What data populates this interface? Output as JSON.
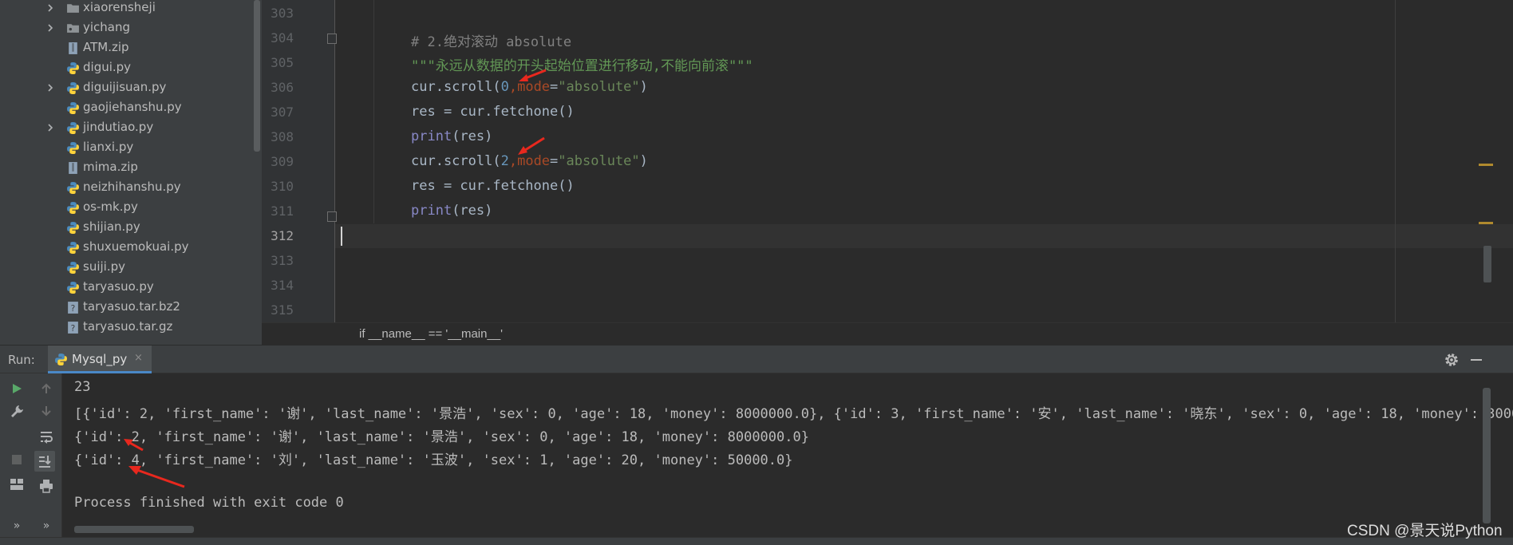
{
  "project_tree": {
    "items": [
      {
        "label": "xiaorensheji",
        "type": "folder",
        "expandable": true
      },
      {
        "label": "yichang",
        "type": "package",
        "expandable": true
      },
      {
        "label": "ATM.zip",
        "type": "zip",
        "expandable": false
      },
      {
        "label": "digui.py",
        "type": "python",
        "expandable": false
      },
      {
        "label": "diguijisuan.py",
        "type": "python",
        "expandable": true
      },
      {
        "label": "gaojiehanshu.py",
        "type": "python",
        "expandable": false
      },
      {
        "label": "jindutiao.py",
        "type": "python",
        "expandable": true
      },
      {
        "label": "lianxi.py",
        "type": "python",
        "expandable": false
      },
      {
        "label": "mima.zip",
        "type": "zip",
        "expandable": false
      },
      {
        "label": "neizhihanshu.py",
        "type": "python",
        "expandable": false
      },
      {
        "label": "os-mk.py",
        "type": "python",
        "expandable": false
      },
      {
        "label": "shijian.py",
        "type": "python",
        "expandable": false
      },
      {
        "label": "shuxuemokuai.py",
        "type": "python",
        "expandable": false
      },
      {
        "label": "suiji.py",
        "type": "python",
        "expandable": false
      },
      {
        "label": "taryasuo.py",
        "type": "python",
        "expandable": false
      },
      {
        "label": "taryasuo.tar.bz2",
        "type": "unknown",
        "expandable": false
      },
      {
        "label": "taryasuo.tar.gz",
        "type": "unknown",
        "expandable": false
      }
    ]
  },
  "editor": {
    "line_numbers": [
      "303",
      "304",
      "305",
      "306",
      "307",
      "308",
      "309",
      "310",
      "311",
      "312",
      "313",
      "314",
      "315"
    ],
    "current_line": "312",
    "code": {
      "l304_comment": "# 2.绝对滚动 absolute",
      "l305_doc": "\"\"\"永远从数据的开头起始位置进行移动,不能向前滚\"\"\"",
      "l306_a": "cur.scroll(",
      "l306_num": "0",
      "l306_comma": ",",
      "l306_kw": "mode",
      "l306_eq": "=",
      "l306_str": "\"absolute\"",
      "l306_close": ")",
      "l307": "res = cur.fetchone()",
      "l308_fn": "print",
      "l308_rest": "(res)",
      "l309_a": "cur.scroll(",
      "l309_num": "2",
      "l309_comma": ",",
      "l309_kw": "mode",
      "l309_eq": "=",
      "l309_str": "\"absolute\"",
      "l309_close": ")",
      "l310": "res = cur.fetchone()",
      "l311_fn": "print",
      "l311_rest": "(res)"
    },
    "breadcrumb": "if __name__ == '__main__'"
  },
  "run_window": {
    "title": "Run:",
    "tab_label": "Mysql_py",
    "tab_close": "×",
    "console_lines": [
      "23",
      "[{'id': 2, 'first_name': '谢', 'last_name': '景浩', 'sex': 0, 'age': 18, 'money': 8000000.0}, {'id': 3, 'first_name': '安', 'last_name': '晓东', 'sex': 0, 'age': 18, 'money': 30000",
      "{'id': 2, 'first_name': '谢', 'last_name': '景浩', 'sex': 0, 'age': 18, 'money': 8000000.0}",
      "{'id': 4, 'first_name': '刘', 'last_name': '玉波', 'sex': 1, 'age': 20, 'money': 50000.0}",
      "",
      "Process finished with exit code 0"
    ],
    "more_label": "»"
  },
  "watermark": "CSDN @景天说Python",
  "colors": {
    "accent": "#4a88c7",
    "annotation_arrow": "#e8281e",
    "run_green": "#59a869"
  }
}
